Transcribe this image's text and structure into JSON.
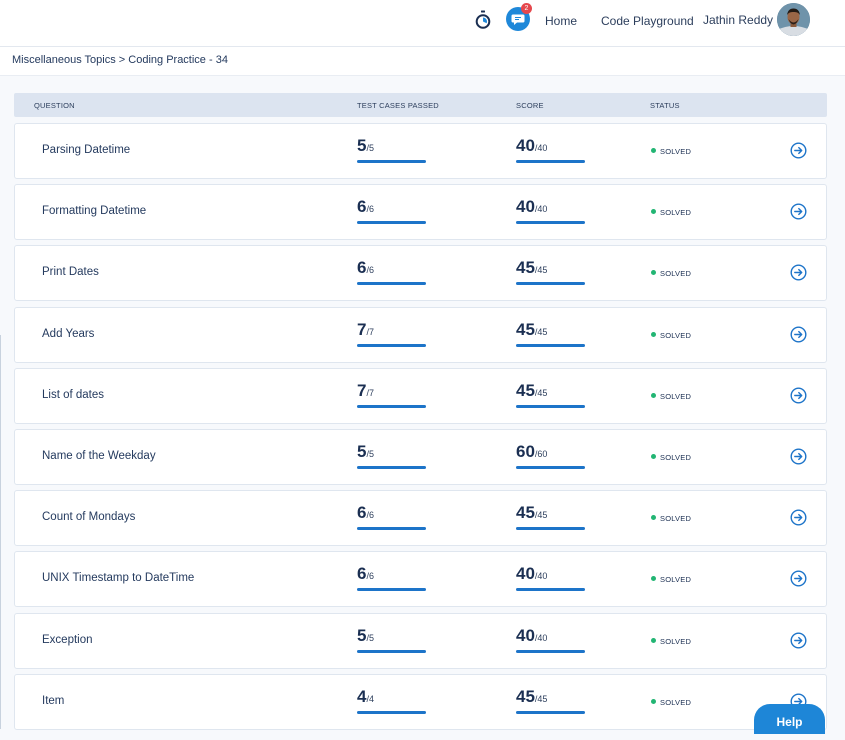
{
  "header": {
    "chat_badge_count": "2",
    "nav": {
      "home": "Home",
      "code_playground": "Code Playground"
    },
    "user_name": "Jathin Reddy"
  },
  "breadcrumb": "Miscellaneous Topics > Coding Practice - 34",
  "table": {
    "columns": {
      "question": "QUESTION",
      "test_cases": "TEST CASES PASSED",
      "score": "SCORE",
      "status": "STATUS"
    },
    "rows": [
      {
        "name": "Parsing Datetime",
        "tc_passed": "5",
        "tc_total": "/5",
        "score": "40",
        "score_total": "/40",
        "status": "SOLVED"
      },
      {
        "name": "Formatting Datetime",
        "tc_passed": "6",
        "tc_total": "/6",
        "score": "40",
        "score_total": "/40",
        "status": "SOLVED"
      },
      {
        "name": "Print Dates",
        "tc_passed": "6",
        "tc_total": "/6",
        "score": "45",
        "score_total": "/45",
        "status": "SOLVED"
      },
      {
        "name": "Add Years",
        "tc_passed": "7",
        "tc_total": "/7",
        "score": "45",
        "score_total": "/45",
        "status": "SOLVED"
      },
      {
        "name": "List of dates",
        "tc_passed": "7",
        "tc_total": "/7",
        "score": "45",
        "score_total": "/45",
        "status": "SOLVED"
      },
      {
        "name": "Name of the Weekday",
        "tc_passed": "5",
        "tc_total": "/5",
        "score": "60",
        "score_total": "/60",
        "status": "SOLVED"
      },
      {
        "name": "Count of Mondays",
        "tc_passed": "6",
        "tc_total": "/6",
        "score": "45",
        "score_total": "/45",
        "status": "SOLVED"
      },
      {
        "name": "UNIX Timestamp to DateTime",
        "tc_passed": "6",
        "tc_total": "/6",
        "score": "40",
        "score_total": "/40",
        "status": "SOLVED"
      },
      {
        "name": "Exception",
        "tc_passed": "5",
        "tc_total": "/5",
        "score": "40",
        "score_total": "/40",
        "status": "SOLVED"
      },
      {
        "name": "Item",
        "tc_passed": "4",
        "tc_total": "/4",
        "score": "45",
        "score_total": "/45",
        "status": "SOLVED"
      }
    ]
  },
  "help_button": "Help",
  "icons": {
    "timer": "stopwatch-icon",
    "chat": "chat-icon",
    "row_action": "arrow-right-circle-icon",
    "status": "status-dot-icon"
  },
  "colors": {
    "accent": "#1d74c9",
    "status_solved": "#22b573",
    "badge": "#e5484d",
    "header_bg": "#dce4f0"
  }
}
